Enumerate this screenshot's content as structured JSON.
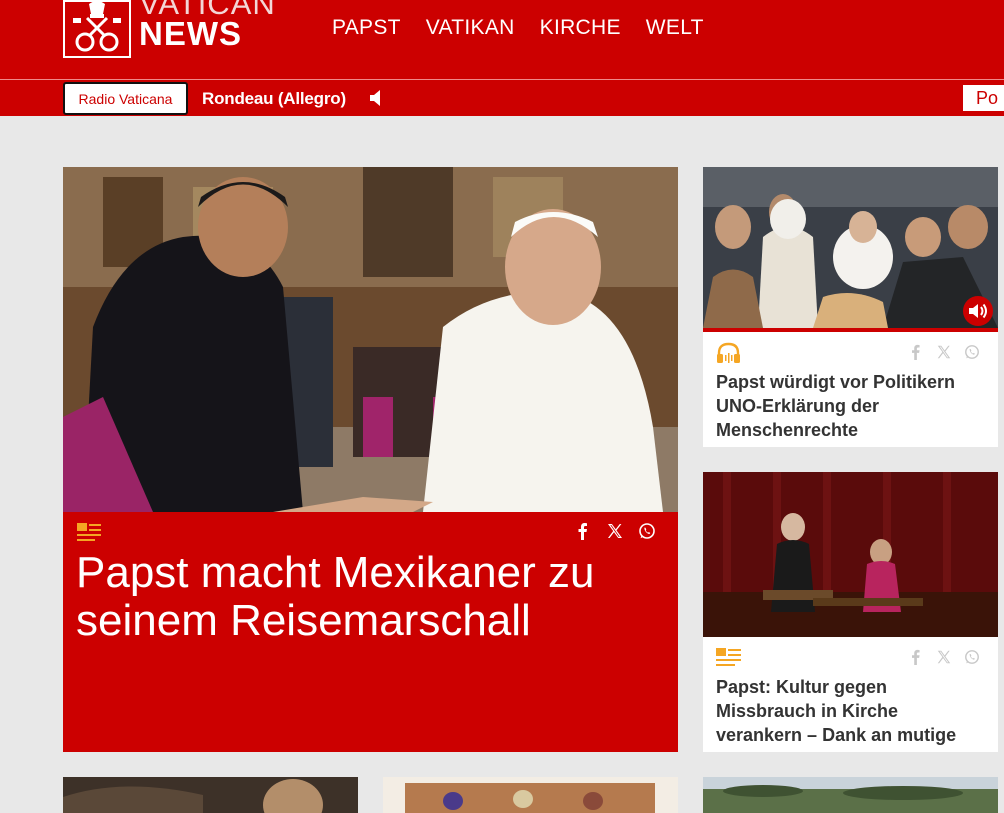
{
  "header": {
    "logo_top": "VATICAN",
    "logo_bottom": "NEWS",
    "nav": [
      {
        "label": "PAPST"
      },
      {
        "label": "VATIKAN"
      },
      {
        "label": "KIRCHE"
      },
      {
        "label": "WELT"
      }
    ]
  },
  "radio": {
    "station_label": "Radio Vaticana",
    "now_playing": "Rondeau (Allegro)",
    "podcast_label": "Po"
  },
  "hero": {
    "title": "Papst macht Mexikaner zu seinem Reisemarschall",
    "type_icon": "article-icon",
    "share_icons": [
      "facebook-icon",
      "x-icon",
      "whatsapp-icon"
    ]
  },
  "side_cards": [
    {
      "title": "Papst würdigt vor Politikern UNO-Erklärung der Menschenrechte",
      "type_icon": "headphones-icon",
      "audio": true
    },
    {
      "title": "Papst: Kultur gegen Missbrauch in Kirche verankern – Dank an mutige",
      "type_icon": "article-icon",
      "audio": false
    }
  ],
  "colors": {
    "brand_red": "#cc0000",
    "accent_orange": "#f5a623",
    "page_bg": "#e8e8e8"
  }
}
